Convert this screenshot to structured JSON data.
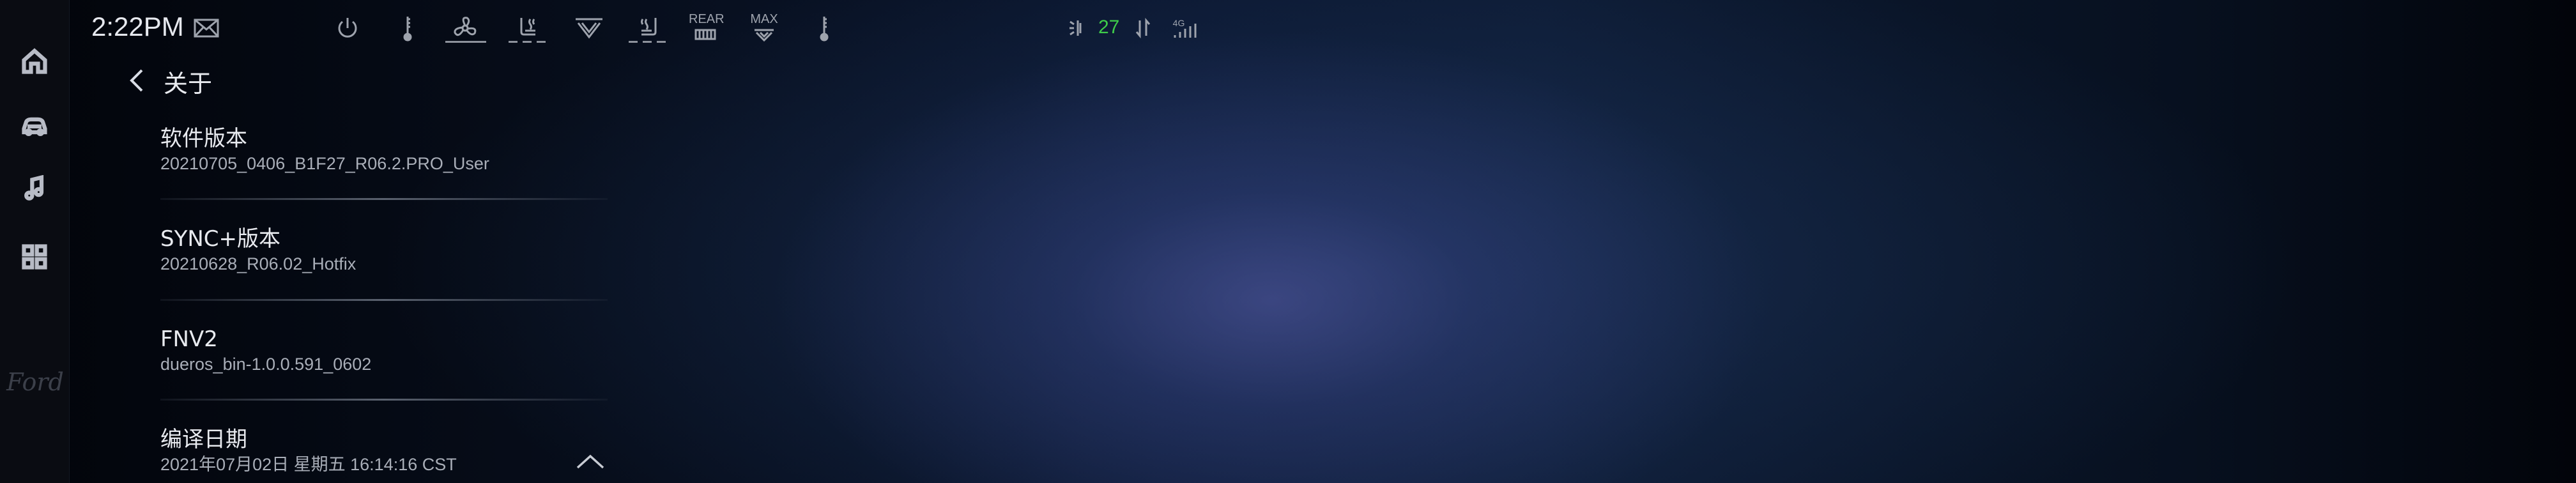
{
  "status_bar": {
    "time": "2:22PM",
    "climate_rear_label": "REAR",
    "climate_max_label": "MAX",
    "signal_value": "27",
    "network_label": "4G"
  },
  "header": {
    "title": "关于"
  },
  "about_items": [
    {
      "label": "软件版本",
      "value": "20210705_0406_B1F27_R06.2.PRO_User"
    },
    {
      "label": "SYNC+版本",
      "value": "20210628_R06.02_Hotfix"
    },
    {
      "label": "FNV2",
      "value": "dueros_bin-1.0.0.591_0602"
    },
    {
      "label": "编译日期",
      "value": "2021年07月02日  星期五 16:14:16 CST"
    }
  ],
  "sidebar": {
    "items": [
      "home-icon",
      "car-icon",
      "music-icon",
      "apps-icon"
    ],
    "logo": "Ford"
  },
  "colors": {
    "signal_green": "#3ecc4a",
    "text_primary": "#e8eaef",
    "text_secondary": "#a9aeb8"
  }
}
